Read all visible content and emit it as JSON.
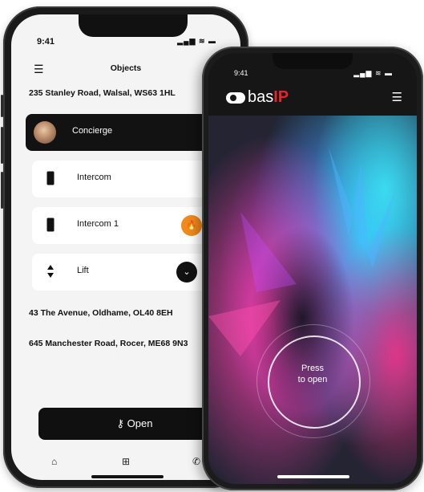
{
  "back_phone": {
    "status": {
      "time": "9:41",
      "icons": "▂▄▆ ≋ ▬"
    },
    "header": {
      "menu_icon": "hamburger-icon",
      "title": "Objects"
    },
    "addresses": [
      "235 Stanley Road, Walsal, WS63 1HL",
      "43 The Avenue, Oldhame, OL40 8EH",
      "645 Manchester Road, Rocer, ME68 9N3"
    ],
    "items": [
      {
        "label": "Concierge",
        "icon": "avatar",
        "action_icon": "phone-icon"
      },
      {
        "label": "Intercom",
        "icon": "intercom-device-icon",
        "action_icon": "circle-icon"
      },
      {
        "label": "Intercom 1",
        "icon": "intercom-device-icon",
        "action_icon": "fire-icon",
        "action_icon_2": "circle-icon"
      },
      {
        "label": "Lift",
        "icon": "lift-arrows-icon",
        "action_icon": "chevron-down-icon",
        "action_icon_2": "chevron-up-icon"
      }
    ],
    "open_button": {
      "label": "Open",
      "icon": "key-icon"
    },
    "tabbar": [
      "home-icon",
      "plus-square-icon",
      "phone-icon"
    ],
    "colors": {
      "accent": "#f08a1c",
      "dark": "#121212"
    }
  },
  "front_phone": {
    "status": {
      "time": "9:41",
      "icons": "▂▄▆ ≋ ▬"
    },
    "logo": {
      "text": "bas",
      "suffix": "IP"
    },
    "menu_icon": "hamburger-icon",
    "press": {
      "line1": "Press",
      "line2": "to open"
    },
    "colors": {
      "brand_red": "#e4232b"
    }
  }
}
